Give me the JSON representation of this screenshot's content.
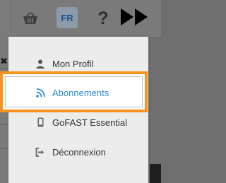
{
  "header": {
    "language_label": "FR",
    "help_label": "?"
  },
  "background": {
    "close_label": "✖"
  },
  "menu": {
    "items": [
      {
        "label": "Mon Profil",
        "icon": "user-icon"
      },
      {
        "label": "Abonnements",
        "icon": "rss-icon",
        "highlighted": true
      },
      {
        "label": "GoFAST Essential",
        "icon": "mobile-icon"
      },
      {
        "label": "Déconnexion",
        "icon": "logout-icon"
      }
    ]
  },
  "colors": {
    "highlight_border": "#f7931e",
    "active_text": "#2d8ad8"
  }
}
